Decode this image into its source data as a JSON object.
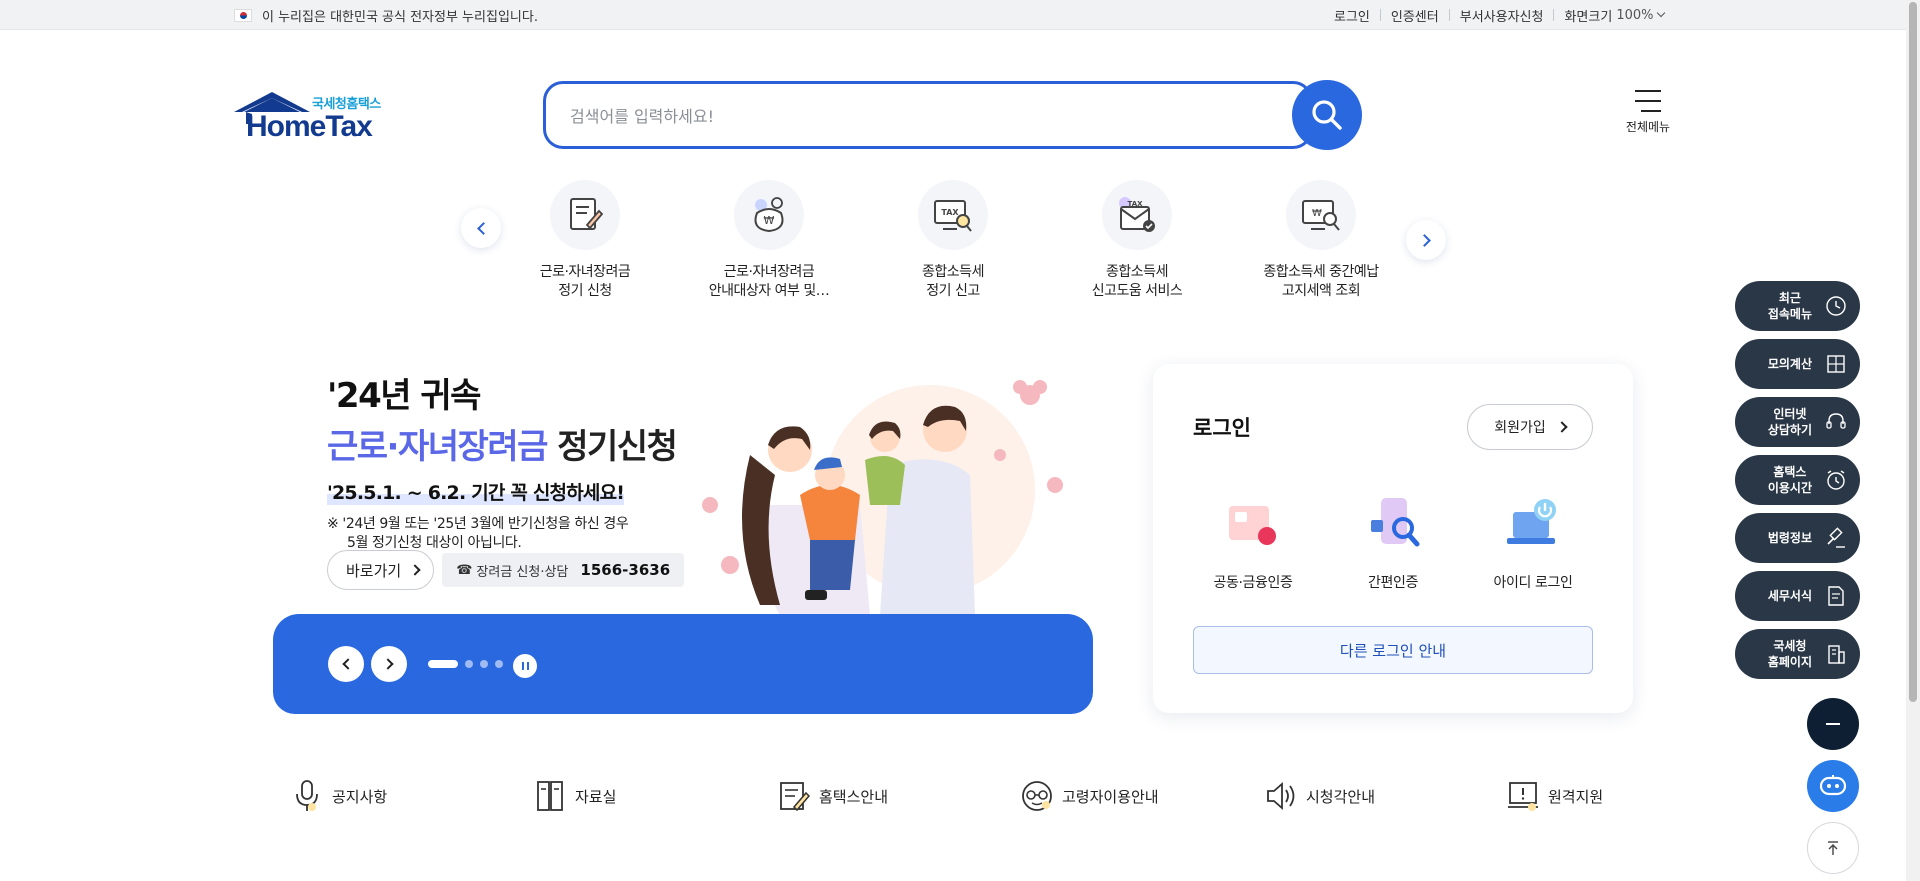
{
  "gov_bar": {
    "notice": "이 누리집은 대한민국 공식 전자정부 누리집입니다.",
    "links": [
      "로그인",
      "인증센터",
      "부서사용자신청",
      "화면크기"
    ],
    "zoom": "100%"
  },
  "header": {
    "logo_sub": "국세청홈택스",
    "logo_main": "HomeTax",
    "search_placeholder": "검색어를 입력하세요!",
    "all_menu_label": "전체메뉴"
  },
  "quick_menu": [
    {
      "line1": "근로·자녀장려금",
      "line2": "정기 신청",
      "icon": "document-pen-icon"
    },
    {
      "line1": "근로·자녀장려금",
      "line2": "안내대상자 여부 및…",
      "icon": "money-bag-icon"
    },
    {
      "line1": "종합소득세",
      "line2": "정기 신고",
      "icon": "tax-monitor-search-icon"
    },
    {
      "line1": "종합소득세",
      "line2": "신고도움 서비스",
      "icon": "tax-mail-check-icon"
    },
    {
      "line1": "종합소득세 중간예납",
      "line2": "고지세액 조회",
      "icon": "monitor-search-icon"
    }
  ],
  "banner": {
    "line1": "'24년 귀속",
    "line2_highlight": "근로·자녀장려금",
    "line2_rest": " 정기신청",
    "line3": "'25.5.1. ~ 6.2. 기간 꼭 신청하세요!",
    "note_line1": "※ '24년 9월 또는 '25년 3월에 반기신청을 하신 경우",
    "note_line2": "5월 정기신청 대상이 아닙니다.",
    "go_button": "바로가기",
    "phone_label": "장려금 신청·상담",
    "phone_number": "1566-3636",
    "slide_count": 4,
    "active_slide": 1
  },
  "login": {
    "title": "로그인",
    "join_button": "회원가입",
    "options": [
      {
        "label": "공동·금융인증",
        "icon": "certificate-card-icon"
      },
      {
        "label": "간편인증",
        "icon": "phone-search-icon"
      },
      {
        "label": "아이디 로그인",
        "icon": "laptop-power-icon"
      }
    ],
    "other_button": "다른 로그인 안내"
  },
  "bottom_links": [
    {
      "label": "공지사항",
      "icon": "microphone-icon"
    },
    {
      "label": "자료실",
      "icon": "folder-cabinet-icon"
    },
    {
      "label": "홈택스안내",
      "icon": "notepad-pen-icon"
    },
    {
      "label": "고령자이용안내",
      "icon": "glasses-face-icon"
    },
    {
      "label": "시청각안내",
      "icon": "speaker-icon"
    },
    {
      "label": "원격지원",
      "icon": "monitor-alert-icon"
    }
  ],
  "side_menu": [
    {
      "line1": "최근",
      "line2": "접속메뉴",
      "icon": "clock-icon"
    },
    {
      "line1": "모의계산",
      "line2": "",
      "icon": "calculator-icon"
    },
    {
      "line1": "인터넷",
      "line2": "상담하기",
      "icon": "headset-icon"
    },
    {
      "line1": "홈택스",
      "line2": "이용시간",
      "icon": "alarm-clock-icon"
    },
    {
      "line1": "법령정보",
      "line2": "",
      "icon": "gavel-icon"
    },
    {
      "line1": "세무서식",
      "line2": "",
      "icon": "form-document-icon"
    },
    {
      "line1": "국세청",
      "line2": "홈페이지",
      "icon": "building-icon"
    }
  ],
  "colors": {
    "brand_blue": "#2a68e0",
    "logo_navy": "#123a8f",
    "side_menu_bg": "#2a3746",
    "highlight_purple": "#5a67e6"
  }
}
